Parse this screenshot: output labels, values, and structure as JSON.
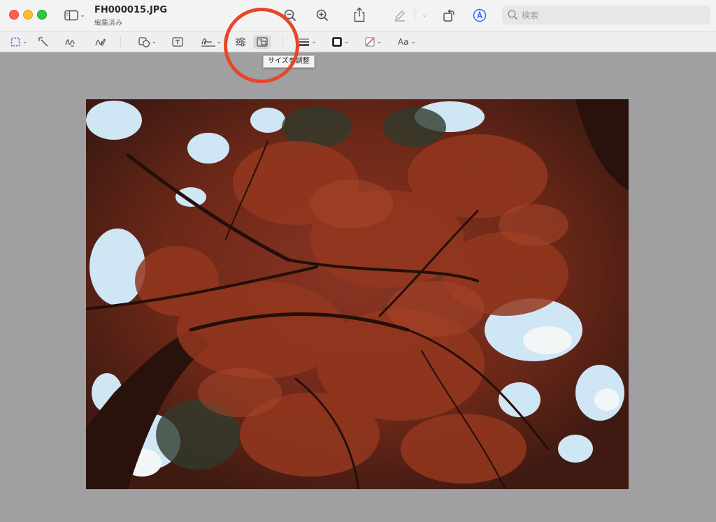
{
  "window": {
    "file_name": "FH000015.JPG",
    "status": "編集済み"
  },
  "search": {
    "placeholder": "検索",
    "value": ""
  },
  "toolbar": {
    "text_style_label": "Aa"
  },
  "tooltip": {
    "text": "サイズを調整"
  },
  "colors": {
    "annotation_circle": "#e8462c",
    "markup_accent": "#2a6cf3",
    "canvas_background": "#a09fa2"
  },
  "icons": [
    "sidebar-icon",
    "zoom-out-icon",
    "zoom-in-icon",
    "share-icon",
    "pen-icon",
    "rotate-icon",
    "markup-icon",
    "search-icon",
    "rect-select-icon",
    "instant-alpha-icon",
    "sketch-icon",
    "draw-icon",
    "shapes-icon",
    "text-box-icon",
    "signature-icon",
    "adjust-color-icon",
    "adjust-size-icon",
    "line-style-icon",
    "border-color-icon",
    "fill-color-icon"
  ]
}
